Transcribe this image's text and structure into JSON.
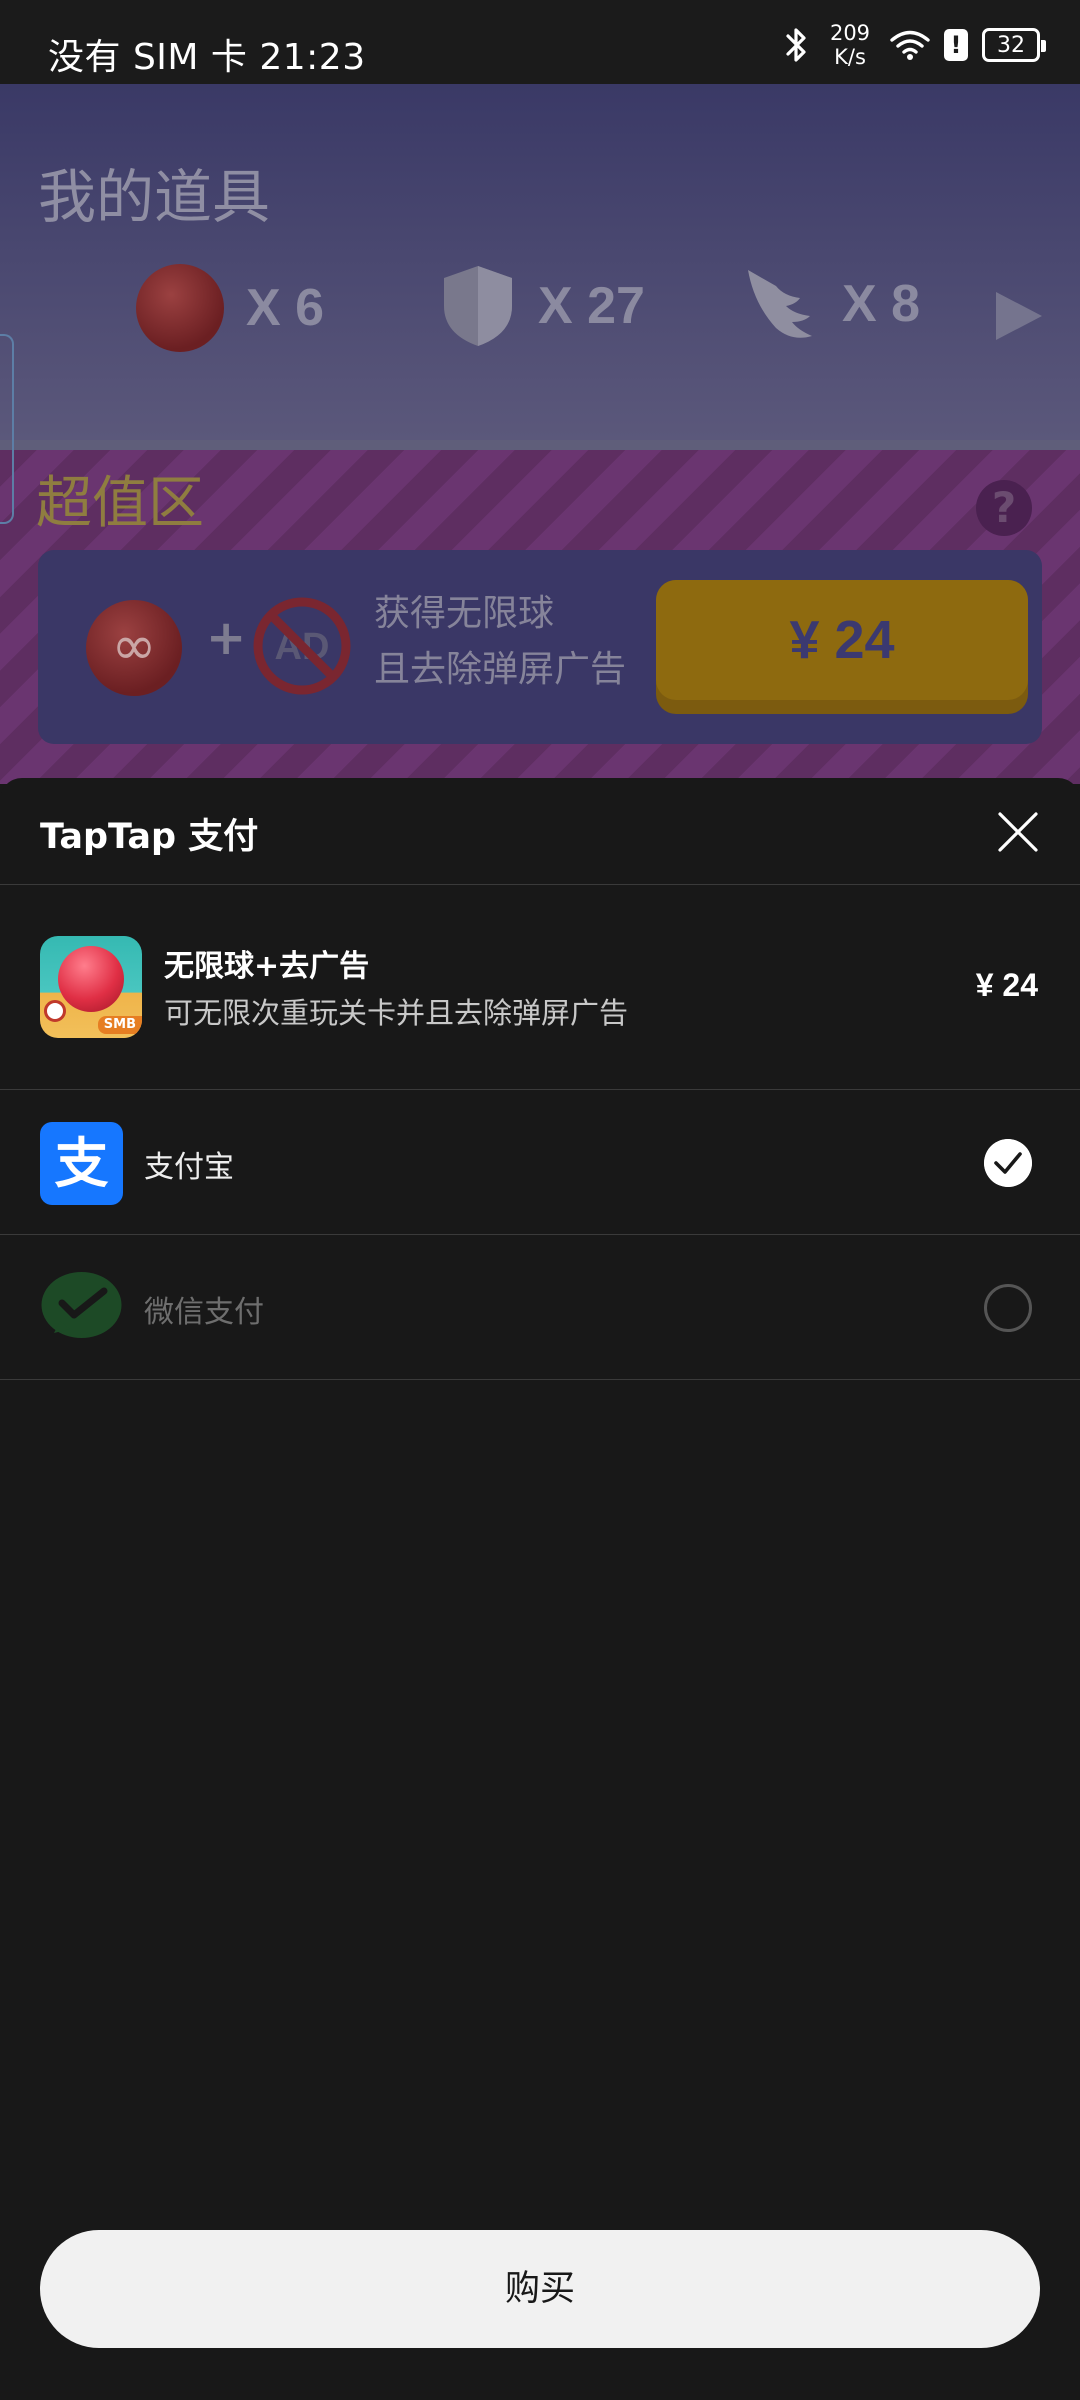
{
  "status_bar": {
    "carrier_time": "没有 SIM 卡 21:23",
    "net_speed_value": "209",
    "net_speed_unit": "K/s",
    "battery": "32",
    "icons": [
      "bluetooth-icon",
      "wifi-icon",
      "alert-icon",
      "battery-icon"
    ]
  },
  "background_game": {
    "title": "我的道具",
    "items": [
      {
        "icon": "ball-icon",
        "count": "X 6"
      },
      {
        "icon": "shield-icon",
        "count": "X 27"
      },
      {
        "icon": "wing-icon",
        "count": "X 8"
      }
    ],
    "promo_title": "超值区",
    "help": "?",
    "deal": {
      "infinity": "∞",
      "plus": "+",
      "noad_text": "AD",
      "line1": "获得无限球",
      "line2": "且去除弹屏广告",
      "price": "¥ 24"
    }
  },
  "sheet": {
    "title": "TapTap 支付",
    "product": {
      "name": "无限球+去广告",
      "description": "可无限次重玩关卡并且去除弹屏广告",
      "price": "¥ 24",
      "thumb_tag": "SMB"
    },
    "payment_methods": [
      {
        "label": "支付宝",
        "icon": "alipay-icon",
        "icon_glyph": "支",
        "selected": true
      },
      {
        "label": "微信支付",
        "icon": "wechat-pay-icon",
        "selected": false
      }
    ],
    "buy_label": "购买"
  },
  "colors": {
    "sheet_bg": "#181818",
    "alipay_blue": "#1677ff",
    "button_bg": "#f1f1f1",
    "price_gold": "#8e6a0f"
  }
}
